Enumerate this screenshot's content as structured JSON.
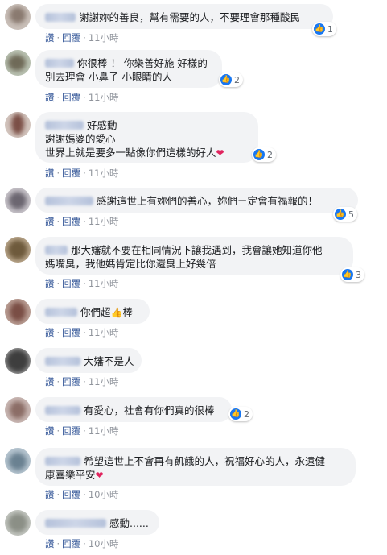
{
  "comments": [
    {
      "lines": [
        "謝謝妳的善良，幫有需要的人，不要理會那種酸民"
      ],
      "reactions": "1",
      "actions": {
        "like": "讚",
        "reply": "回覆",
        "time": "11小時"
      }
    },
    {
      "lines": [
        "你很棒 ！ 你樂善好施 好樣的",
        "別去理會 小鼻子 小眼睛的人"
      ],
      "reactions": "2",
      "actions": {
        "like": "讚",
        "reply": "回覆",
        "time": "11小時"
      }
    },
    {
      "lines": [
        "好感動",
        "謝謝媽婆的愛心",
        "世界上就是要多一點像你們這樣的好人"
      ],
      "reactions": "2",
      "actions": {
        "like": "讚",
        "reply": "回覆",
        "time": "11小時"
      }
    },
    {
      "lines": [
        "感謝這世上有妳們的善心，妳們ㄧ定會有福報的！"
      ],
      "reactions": "5",
      "actions": {
        "like": "讚",
        "reply": "回覆",
        "time": "11小時"
      }
    },
    {
      "lines": [
        "那大嬸就不要在相同情況下讓我遇到，我會讓她知道你他",
        "媽嘴臭，我他媽肯定比你還臭上好幾倍"
      ],
      "reactions": "3",
      "actions": {
        "like": "讚",
        "reply": "回覆",
        "time": "11小時"
      }
    },
    {
      "lines": [
        "你們超",
        "棒"
      ],
      "reactions": "",
      "actions": {
        "like": "讚",
        "reply": "回覆",
        "time": "11小時"
      }
    },
    {
      "lines": [
        "大嬸不是人"
      ],
      "reactions": "",
      "actions": {
        "like": "讚",
        "reply": "回覆",
        "time": "11小時"
      }
    },
    {
      "lines": [
        "有愛心，社會有你們真的很棒"
      ],
      "reactions": "2",
      "actions": {
        "like": "讚",
        "reply": "回覆",
        "time": "11小時"
      }
    },
    {
      "lines": [
        "希望這世上不會再有飢餓的人，祝福好心的人，永遠健",
        "康喜樂平安"
      ],
      "reactions": "",
      "actions": {
        "like": "讚",
        "reply": "回覆",
        "time": "10小時"
      }
    },
    {
      "lines": [
        "感動......"
      ],
      "reactions": "",
      "actions": {
        "like": "讚",
        "reply": "回覆",
        "time": "10小時"
      }
    }
  ],
  "colors": {
    "bubble": "#f2f3f5",
    "link": "#365899",
    "like": "#1877f2",
    "heart": "#e0245e"
  },
  "icons": {
    "like": "like-icon",
    "heart": "heart-icon",
    "thumbs_up": "thumbs-up-emoji-icon"
  }
}
